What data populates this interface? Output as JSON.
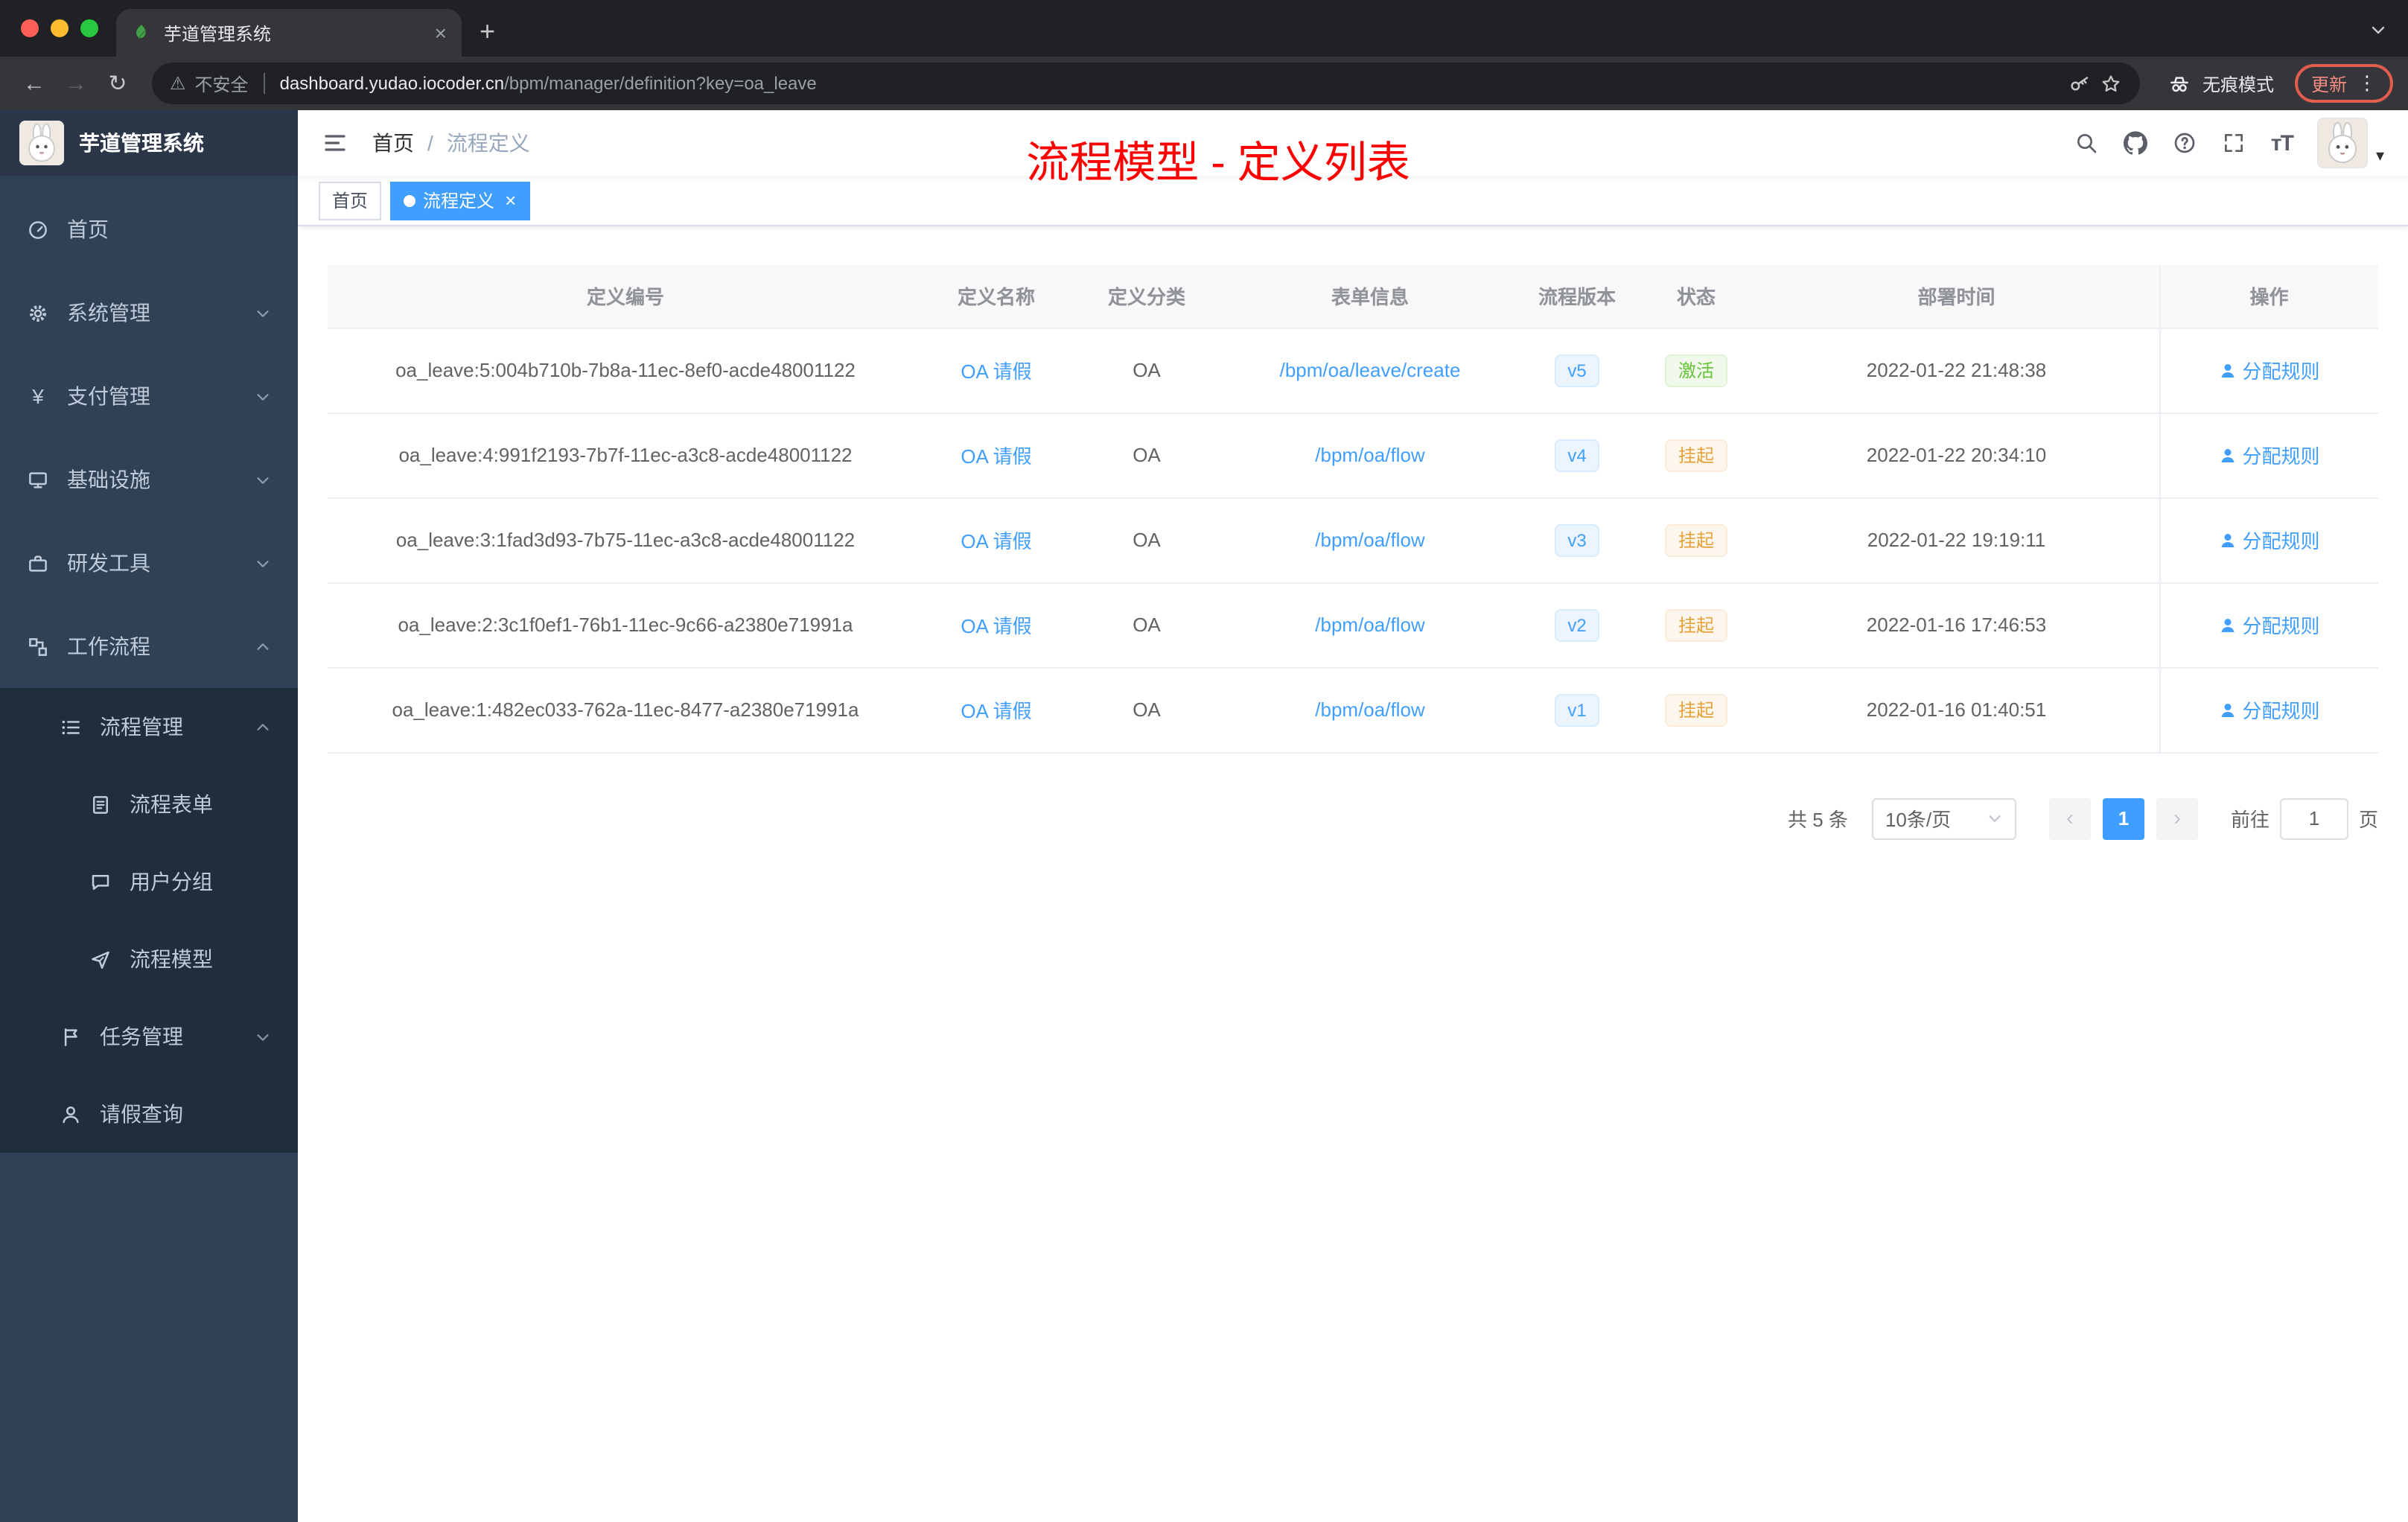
{
  "browser": {
    "tab_title": "芋道管理系统",
    "security_label": "不安全",
    "url_domain": "dashboard.yudao.iocoder.cn",
    "url_path": "/bpm/manager/definition?key=oa_leave",
    "incognito_label": "无痕模式",
    "update_label": "更新"
  },
  "sidebar": {
    "app_title": "芋道管理系统",
    "items": [
      {
        "label": "首页",
        "icon": "dashboard-icon",
        "expandable": false
      },
      {
        "label": "系统管理",
        "icon": "gear-icon",
        "expandable": true
      },
      {
        "label": "支付管理",
        "icon": "yen-icon",
        "expandable": true
      },
      {
        "label": "基础设施",
        "icon": "monitor-icon",
        "expandable": true
      },
      {
        "label": "研发工具",
        "icon": "tools-icon",
        "expandable": true
      },
      {
        "label": "工作流程",
        "icon": "workflow-icon",
        "expandable": true,
        "expanded": true
      }
    ],
    "submenu": [
      {
        "label": "流程管理",
        "icon": "list-icon",
        "level": 2,
        "expanded": true
      },
      {
        "label": "流程表单",
        "icon": "form-icon",
        "level": 3
      },
      {
        "label": "用户分组",
        "icon": "group-icon",
        "level": 3
      },
      {
        "label": "流程模型",
        "icon": "model-icon",
        "level": 3
      },
      {
        "label": "任务管理",
        "icon": "task-icon",
        "level": 2,
        "expandable": true
      },
      {
        "label": "请假查询",
        "icon": "user-icon",
        "level": 2
      }
    ]
  },
  "navbar": {
    "breadcrumb": {
      "home": "首页",
      "separator": "/",
      "current": "流程定义"
    }
  },
  "annotation": {
    "text": "流程模型 - 定义列表",
    "color": "#fe0000"
  },
  "tags": [
    {
      "label": "首页",
      "active": false
    },
    {
      "label": "流程定义",
      "active": true
    }
  ],
  "table": {
    "headers": [
      "定义编号",
      "定义名称",
      "定义分类",
      "表单信息",
      "流程版本",
      "状态",
      "部署时间",
      "操作"
    ],
    "rows": [
      {
        "id": "oa_leave:5:004b710b-7b8a-11ec-8ef0-acde48001122",
        "name": "OA 请假",
        "category": "OA",
        "form": "/bpm/oa/leave/create",
        "version": "v5",
        "status": "激活",
        "status_type": "success",
        "deploy_time": "2022-01-22 21:48:38",
        "action": "分配规则"
      },
      {
        "id": "oa_leave:4:991f2193-7b7f-11ec-a3c8-acde48001122",
        "name": "OA 请假",
        "category": "OA",
        "form": "/bpm/oa/flow",
        "version": "v4",
        "status": "挂起",
        "status_type": "warning",
        "deploy_time": "2022-01-22 20:34:10",
        "action": "分配规则"
      },
      {
        "id": "oa_leave:3:1fad3d93-7b75-11ec-a3c8-acde48001122",
        "name": "OA 请假",
        "category": "OA",
        "form": "/bpm/oa/flow",
        "version": "v3",
        "status": "挂起",
        "status_type": "warning",
        "deploy_time": "2022-01-22 19:19:11",
        "action": "分配规则"
      },
      {
        "id": "oa_leave:2:3c1f0ef1-76b1-11ec-9c66-a2380e71991a",
        "name": "OA 请假",
        "category": "OA",
        "form": "/bpm/oa/flow",
        "version": "v2",
        "status": "挂起",
        "status_type": "warning",
        "deploy_time": "2022-01-16 17:46:53",
        "action": "分配规则"
      },
      {
        "id": "oa_leave:1:482ec033-762a-11ec-8477-a2380e71991a",
        "name": "OA 请假",
        "category": "OA",
        "form": "/bpm/oa/flow",
        "version": "v1",
        "status": "挂起",
        "status_type": "warning",
        "deploy_time": "2022-01-16 01:40:51",
        "action": "分配规则"
      }
    ]
  },
  "pagination": {
    "total_label": "共 5 条",
    "page_size_label": "10条/页",
    "current_page": "1",
    "goto_label": "前往",
    "goto_value": "1",
    "unit_label": "页"
  },
  "icons": {
    "close": "×",
    "new_tab": "+",
    "back": "←",
    "forward": "→",
    "reload": "↻",
    "warning": "⚠",
    "more": "⋮",
    "caret_down": "▾",
    "prev_arrow": "‹",
    "next_arrow": "›",
    "yen": "¥",
    "font_size": "тT"
  },
  "colors": {
    "accent": "#409eff",
    "success": "#67c23a",
    "warning": "#e6a23c",
    "annotation": "#fe0000",
    "sidebar_bg": "#304156",
    "submenu_bg": "#1f2d3d"
  }
}
